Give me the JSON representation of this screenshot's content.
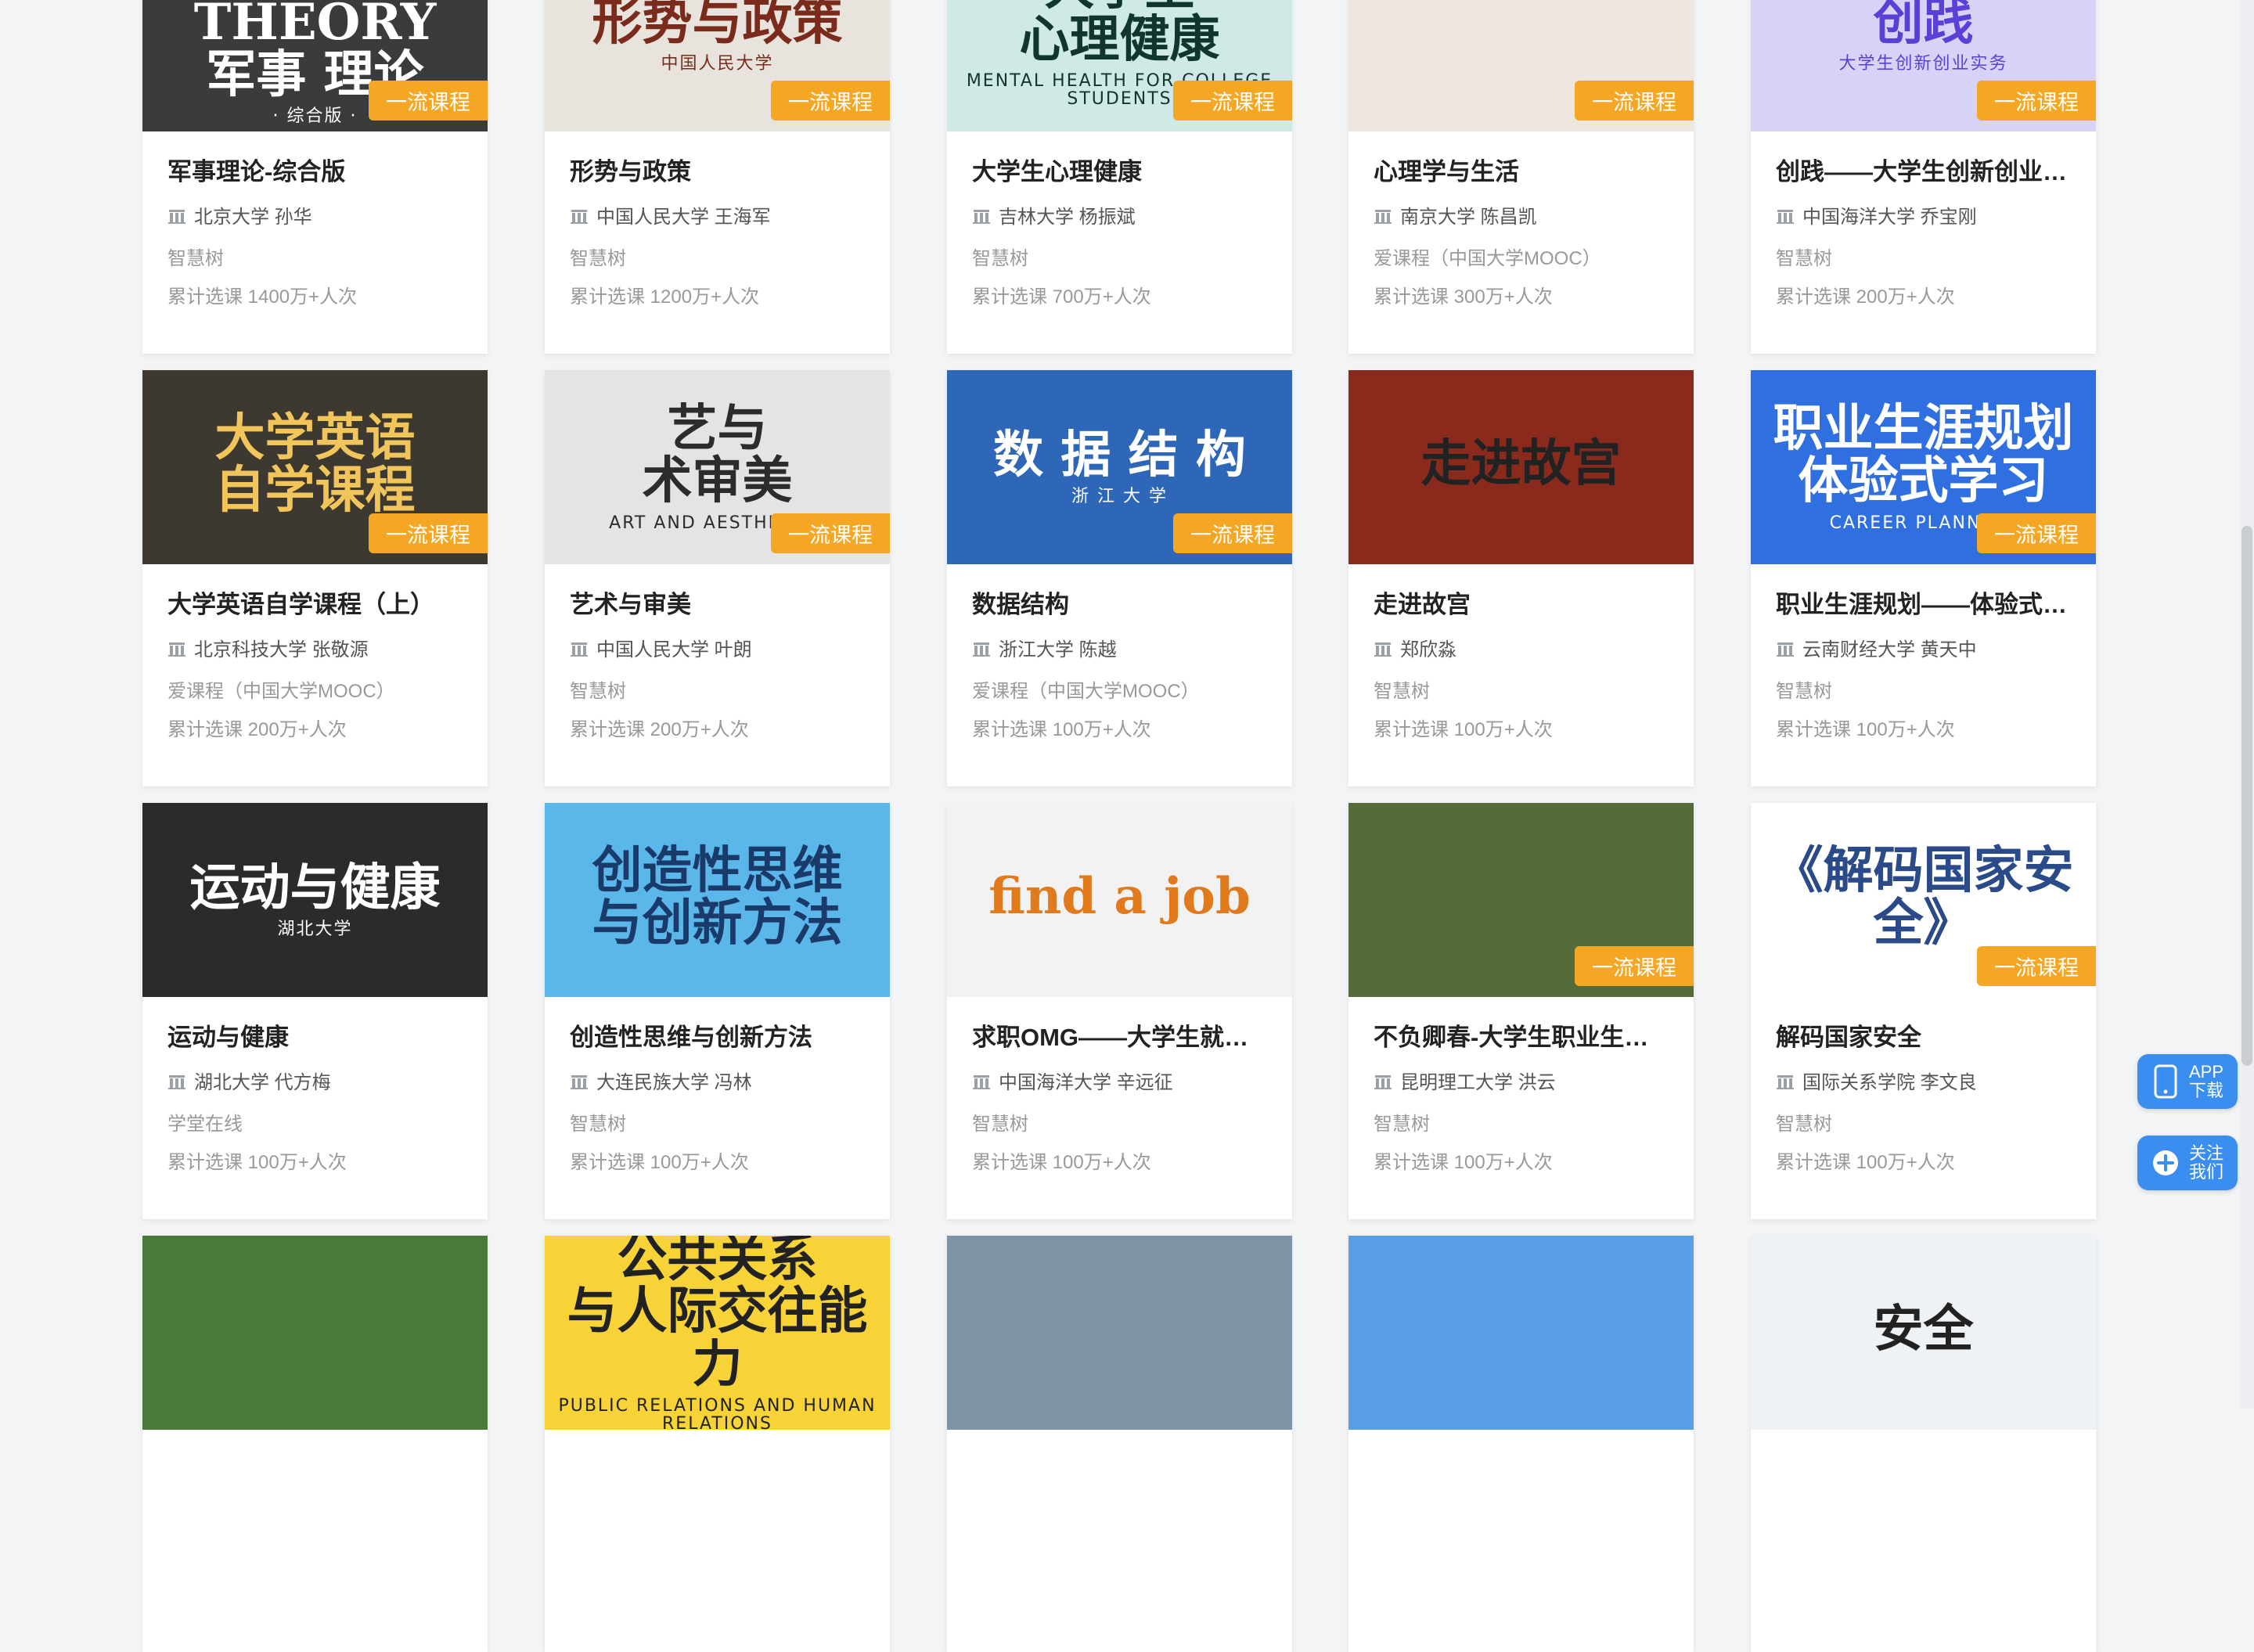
{
  "badge_label": "一流课程",
  "courses": [
    {
      "title": "军事理论-综合版",
      "uni": "北京大学 孙华",
      "platform": "智慧树",
      "count": "累计选课 1400万+人次",
      "cover_text": "MILITARY THEORY\n军事 理论",
      "cover_sub": "· 综合版 ·",
      "cover_bg": "#3a3b3d",
      "cover_fg": "#ffffff",
      "badge": true
    },
    {
      "title": "形势与政策",
      "uni": "中国人民大学 王海军",
      "platform": "智慧树",
      "count": "累计选课 1200万+人次",
      "cover_text": "形势与政策",
      "cover_sub": "中国人民大学",
      "cover_bg": "#e8e3dc",
      "cover_fg": "#7a2b1c",
      "badge": true
    },
    {
      "title": "大学生心理健康",
      "uni": "吉林大学 杨振斌",
      "platform": "智慧树",
      "count": "累计选课 700万+人次",
      "cover_text": "大学生\n心理健康",
      "cover_sub": "MENTAL HEALTH FOR COLLEGE STUDENTS",
      "cover_bg": "#cfe9e6",
      "cover_fg": "#11362f",
      "badge": true
    },
    {
      "title": "心理学与生活",
      "uni": "南京大学 陈昌凯",
      "platform": "爱课程（中国大学MOOC）",
      "count": "累计选课 300万+人次",
      "cover_text": "",
      "cover_sub": "",
      "cover_bg": "#efe6df",
      "cover_fg": "#333333",
      "badge": true
    },
    {
      "title": "创践——大学生创新创业实务",
      "uni": "中国海洋大学 乔宝刚",
      "platform": "智慧树",
      "count": "累计选课 200万+人次",
      "cover_text": "创践",
      "cover_sub": "大学生创新创业实务",
      "cover_bg": "#d7d3f6",
      "cover_fg": "#5b3fd6",
      "badge": true
    },
    {
      "title": "大学英语自学课程（上）",
      "uni": "北京科技大学 张敬源",
      "platform": "爱课程（中国大学MOOC）",
      "count": "累计选课 200万+人次",
      "cover_text": "大学英语\n自学课程",
      "cover_sub": "",
      "cover_bg": "#3d3830",
      "cover_fg": "#f2c55a",
      "badge": true
    },
    {
      "title": "艺术与审美",
      "uni": "中国人民大学 叶朗",
      "platform": "智慧树",
      "count": "累计选课 200万+人次",
      "cover_text": "艺与\n术审美",
      "cover_sub": "ART AND AESTHETICS",
      "cover_bg": "#e4e4e4",
      "cover_fg": "#2c2c2c",
      "badge": true
    },
    {
      "title": "数据结构",
      "uni": "浙江大学 陈越",
      "platform": "爱课程（中国大学MOOC）",
      "count": "累计选课 100万+人次",
      "cover_text": "数 据 结 构",
      "cover_sub": "浙 江 大 学",
      "cover_bg": "#2f67b8",
      "cover_fg": "#ffffff",
      "badge": true
    },
    {
      "title": "走进故宫",
      "uni": "郑欣淼",
      "platform": "智慧树",
      "count": "累计选课 100万+人次",
      "cover_text": "走进故宫",
      "cover_sub": "",
      "cover_bg": "#8a2a1c",
      "cover_fg": "#222222",
      "badge": false
    },
    {
      "title": "职业生涯规划——体验式学习",
      "uni": "云南财经大学 黄天中",
      "platform": "智慧树",
      "count": "累计选课 100万+人次",
      "cover_text": "职业生涯规划\n体验式学习",
      "cover_sub": "CAREER PLANNING",
      "cover_bg": "#2f6fe0",
      "cover_fg": "#ffffff",
      "badge": true
    },
    {
      "title": "运动与健康",
      "uni": "湖北大学 代方梅",
      "platform": "学堂在线",
      "count": "累计选课 100万+人次",
      "cover_text": "运动与健康",
      "cover_sub": "湖北大学",
      "cover_bg": "#2b2b2b",
      "cover_fg": "#ffffff",
      "badge": false
    },
    {
      "title": "创造性思维与创新方法",
      "uni": "大连民族大学 冯林",
      "platform": "智慧树",
      "count": "累计选课 100万+人次",
      "cover_text": "创造性思维\n与创新方法",
      "cover_sub": "",
      "cover_bg": "#5bb7ea",
      "cover_fg": "#1a3a6a",
      "badge": false
    },
    {
      "title": "求职OMG——大学生就业指导",
      "uni": "中国海洋大学 辛远征",
      "platform": "智慧树",
      "count": "累计选课 100万+人次",
      "cover_text": "find a job",
      "cover_sub": "",
      "cover_bg": "#f2f2f2",
      "cover_fg": "#e07a1c",
      "badge": false
    },
    {
      "title": "不负卿春-大学生职业生涯规划",
      "uni": "昆明理工大学 洪云",
      "platform": "智慧树",
      "count": "累计选课 100万+人次",
      "cover_text": "",
      "cover_sub": "",
      "cover_bg": "#556b3a",
      "cover_fg": "#ffffff",
      "badge": true
    },
    {
      "title": "解码国家安全",
      "uni": "国际关系学院 李文良",
      "platform": "智慧树",
      "count": "累计选课 100万+人次",
      "cover_text": "《解码国家安全》",
      "cover_sub": "",
      "cover_bg": "#ffffff",
      "cover_fg": "#2a4a8a",
      "badge": true
    },
    {
      "title": "",
      "uni": "",
      "platform": "",
      "count": "",
      "cover_text": "",
      "cover_sub": "",
      "cover_bg": "#4a7a3a",
      "cover_fg": "#ffffff",
      "badge": false
    },
    {
      "title": "",
      "uni": "",
      "platform": "",
      "count": "",
      "cover_text": "公共关系\n与人际交往能力",
      "cover_sub": "PUBLIC RELATIONS AND HUMAN RELATIONS",
      "cover_bg": "#f7d338",
      "cover_fg": "#222222",
      "badge": false
    },
    {
      "title": "",
      "uni": "",
      "platform": "",
      "count": "",
      "cover_text": "",
      "cover_sub": "",
      "cover_bg": "#7e93a6",
      "cover_fg": "#ffffff",
      "badge": false
    },
    {
      "title": "",
      "uni": "",
      "platform": "",
      "count": "",
      "cover_text": "",
      "cover_sub": "",
      "cover_bg": "#5a9ee6",
      "cover_fg": "#ffffff",
      "badge": false
    },
    {
      "title": "",
      "uni": "",
      "platform": "",
      "count": "",
      "cover_text": "安全",
      "cover_sub": "",
      "cover_bg": "#eef2f5",
      "cover_fg": "#222222",
      "badge": false
    }
  ],
  "side": {
    "app": {
      "label": "APP\n下载",
      "icon": "phone-icon"
    },
    "follow": {
      "label": "关注\n我们",
      "icon": "plus-circle-icon"
    }
  },
  "colors": {
    "badge": "#f5a623",
    "side_button": "#3a8ef0",
    "background": "#f3f4f6"
  }
}
